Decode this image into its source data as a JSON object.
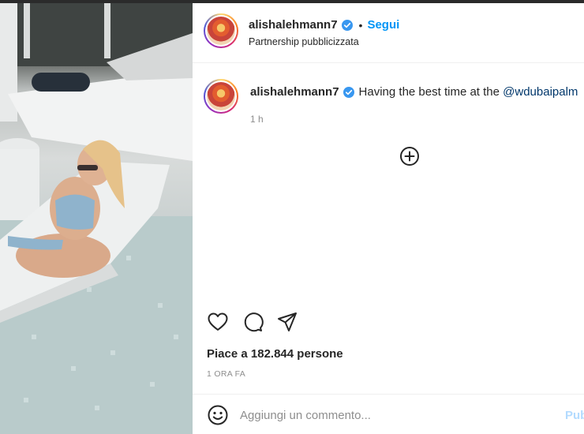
{
  "post": {
    "username": "alishalehmann7",
    "verified": true,
    "separator": "•",
    "follow_label": "Segui",
    "subtitle": "Partnership pubblicizzata"
  },
  "caption": {
    "username": "alishalehmann7",
    "text_prefix": "Having the best time at the ",
    "mention": "@wdubaipalm",
    "time_ago": "1 h"
  },
  "icons": {
    "more": "plus-circle-icon",
    "like": "heart-icon",
    "comment": "comment-icon",
    "share": "paper-plane-icon",
    "emoji": "emoji-icon",
    "verified": "verified-badge-icon"
  },
  "stats": {
    "likes_prefix": "Piace a ",
    "likes_count": "182.844",
    "likes_suffix": " persone",
    "date": "1 ORA FA"
  },
  "comment": {
    "placeholder": "Aggiungi un commento...",
    "publish_label": "Pubblica"
  },
  "colors": {
    "accent": "#0095f6",
    "verified": "#3897f0",
    "mention": "#00376b",
    "muted": "#8e8e8e"
  }
}
